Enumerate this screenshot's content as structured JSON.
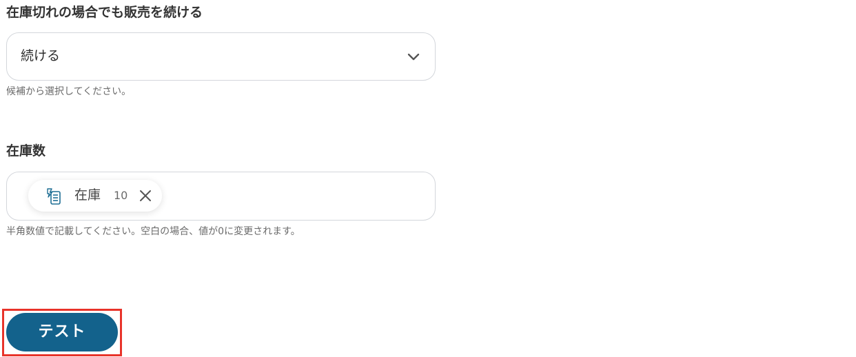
{
  "sell_when_out_of_stock": {
    "label": "在庫切れの場合でも販売を続ける",
    "selected_value": "続ける",
    "help": "候補から選択してください。"
  },
  "stock_quantity": {
    "label": "在庫数",
    "chip": {
      "label": "在庫",
      "value": "10"
    },
    "help": "半角数値で記載してください。空白の場合、値が0に変更されます。"
  },
  "actions": {
    "test_label": "テスト"
  },
  "colors": {
    "primary_button": "#13628c",
    "highlight": "#e8332a",
    "chip_icon": "#1e6e94"
  }
}
